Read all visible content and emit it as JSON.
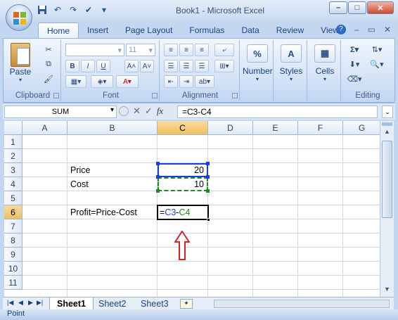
{
  "title": "Book1 - Microsoft Excel",
  "tabs": [
    "Home",
    "Insert",
    "Page Layout",
    "Formulas",
    "Data",
    "Review",
    "View"
  ],
  "ribbon": {
    "groups": {
      "clipboard": "Clipboard",
      "font": "Font",
      "alignment": "Alignment",
      "editing": "Editing"
    },
    "paste_label": "Paste",
    "font_size": "11",
    "number_label": "Number",
    "number_icon": "%",
    "styles_label": "Styles",
    "cells_label": "Cells"
  },
  "formula_bar": {
    "name_box": "SUM",
    "fx": "fx",
    "formula": "=C3-C4"
  },
  "columns": [
    "A",
    "B",
    "C",
    "D",
    "E",
    "F",
    "G"
  ],
  "rows": [
    "1",
    "2",
    "3",
    "4",
    "5",
    "6",
    "7",
    "8",
    "9",
    "10",
    "11"
  ],
  "cells": {
    "B3": "Price",
    "C3": "20",
    "B4": "Cost",
    "C4": "10",
    "B6": "Profit=Price-Cost",
    "C6_eq": "=",
    "C6_ref1": "C3",
    "C6_minus": "-",
    "C6_ref2": "C4"
  },
  "sheets": [
    "Sheet1",
    "Sheet2",
    "Sheet3"
  ],
  "status": "Point",
  "colors": {
    "ref_blue": "#0000ff",
    "ref_green": "#008000",
    "arrow_red": "#e02020",
    "accent": "#c4d7f0"
  }
}
